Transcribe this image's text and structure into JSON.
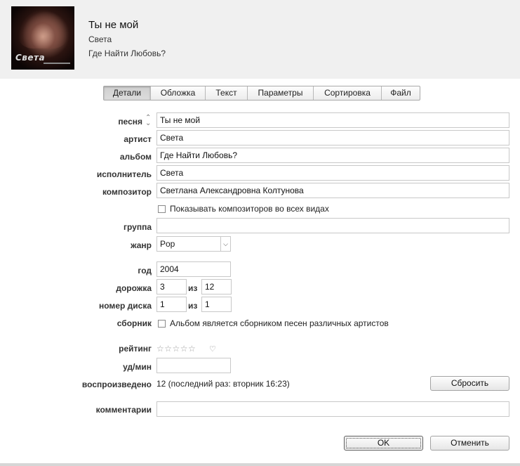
{
  "header": {
    "title": "Ты не мой",
    "artist": "Света",
    "album": "Где Найти Любовь?",
    "artwork_text": "Света"
  },
  "tabs": [
    {
      "label": "Детали",
      "active": true
    },
    {
      "label": "Обложка",
      "active": false
    },
    {
      "label": "Текст",
      "active": false
    },
    {
      "label": "Параметры",
      "active": false
    },
    {
      "label": "Сортировка",
      "active": false
    },
    {
      "label": "Файл",
      "active": false
    }
  ],
  "fields": {
    "song_label": "песня",
    "song_value": "Ты не мой",
    "artist_label": "артист",
    "artist_value": "Света",
    "album_label": "альбом",
    "album_value": "Где Найти Любовь?",
    "album_artist_label": "исполнитель",
    "album_artist_value": "Света",
    "composer_label": "композитор",
    "composer_value": "Светлана Александровна Колтунова",
    "show_composers_label": "Показывать композиторов во всех видах",
    "show_composers_checked": false,
    "grouping_label": "группа",
    "grouping_value": "",
    "genre_label": "жанр",
    "genre_value": "Pop",
    "year_label": "год",
    "year_value": "2004",
    "track_label": "дорожка",
    "track_number": "3",
    "track_of_label": "из",
    "track_total": "12",
    "disc_label": "номер диска",
    "disc_number": "1",
    "disc_of_label": "из",
    "disc_total": "1",
    "compilation_label": "сборник",
    "compilation_checkbox_label": "Альбом является сборником песен различных артистов",
    "compilation_checked": false,
    "rating_label": "рейтинг",
    "rating_stars": "☆☆☆☆☆",
    "rating_value": 0,
    "love_icon": "♡",
    "bpm_label": "уд/мин",
    "bpm_value": "",
    "plays_label": "воспроизведено",
    "plays_value": "12 (последний раз: вторник 16:23)",
    "reset_label": "Сбросить",
    "comments_label": "комментарии",
    "comments_value": ""
  },
  "footer": {
    "ok_label": "OK",
    "cancel_label": "Отменить"
  },
  "colors": {
    "header_bg": "#f0f0f0",
    "label_text": "#333333",
    "field_border": "#c8c8c8"
  }
}
